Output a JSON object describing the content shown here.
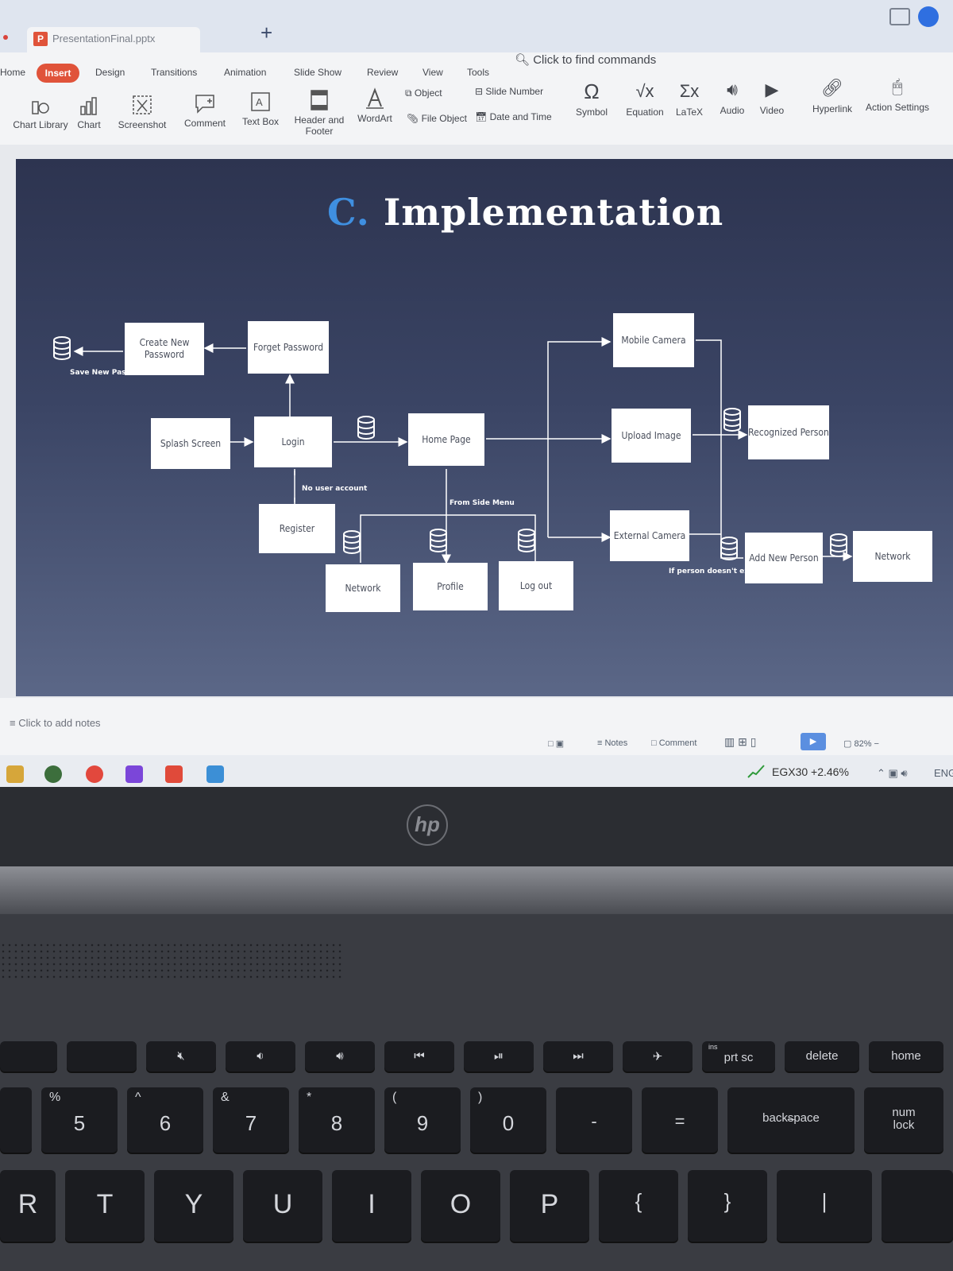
{
  "window": {
    "file_name": "PresentationFinal.pptx",
    "new_tab": "+"
  },
  "menu": {
    "items": [
      "Home",
      "Insert",
      "Design",
      "Transitions",
      "Animation",
      "Slide Show",
      "Review",
      "View",
      "Tools"
    ],
    "active": "Insert",
    "find_commands": "Click to find commands"
  },
  "ribbon": {
    "chart_library": "Chart Library",
    "chart": "Chart",
    "screenshot": "Screenshot",
    "comment": "Comment",
    "text_box": "Text Box",
    "header_footer_1": "Header and",
    "header_footer_2": "Footer",
    "wordart": "WordArt",
    "object": "Object",
    "file_object": "File Object",
    "slide_number": "Slide Number",
    "date_time": "Date and Time",
    "symbol": "Symbol",
    "equation": "Equation",
    "latex": "LaTeX",
    "audio": "Audio",
    "video": "Video",
    "hyperlink": "Hyperlink",
    "action_settings": "Action Settings"
  },
  "slide": {
    "title_letter": "C.",
    "title_text": "Implementation",
    "boxes": {
      "create_new_password": "Create New Password",
      "forget_password": "Forget Password",
      "splash_screen": "Splash Screen",
      "login": "Login",
      "register": "Register",
      "home_page": "Home Page",
      "network_1": "Network",
      "profile": "Profile",
      "log_out": "Log out",
      "mobile_camera": "Mobile Camera",
      "upload_image": "Upload Image",
      "external_camera": "External Camera",
      "recognized_person": "Recognized Person",
      "add_new_person": "Add New Person",
      "network_2": "Network"
    },
    "labels": {
      "save_new_password": "Save New Passwo",
      "no_user_account": "No user account",
      "from_side_menu": "From Side Menu",
      "person_not_exist": "If person doesn't exist"
    }
  },
  "notes": "Click to add notes",
  "statusbar": {
    "notes": "Notes",
    "comment": "Comment",
    "zoom": "82%"
  },
  "taskbar": {
    "ticker": "EGX30  +2.46%",
    "lang": "ENG"
  },
  "laptop": {
    "logo": "hp",
    "keys": {
      "f_row": [
        "prt sc",
        "delete",
        "home"
      ],
      "ins": "ins",
      "num_row": [
        "5",
        "6",
        "7",
        "8",
        "9",
        "0",
        "-",
        "=",
        "backspace",
        "num lock"
      ],
      "num_shift": [
        "%",
        "^",
        "&",
        "*",
        "(",
        ")"
      ],
      "letter_row": [
        "R",
        "T",
        "Y",
        "U",
        "I",
        "O",
        "P",
        "{",
        "}",
        "|"
      ]
    }
  }
}
